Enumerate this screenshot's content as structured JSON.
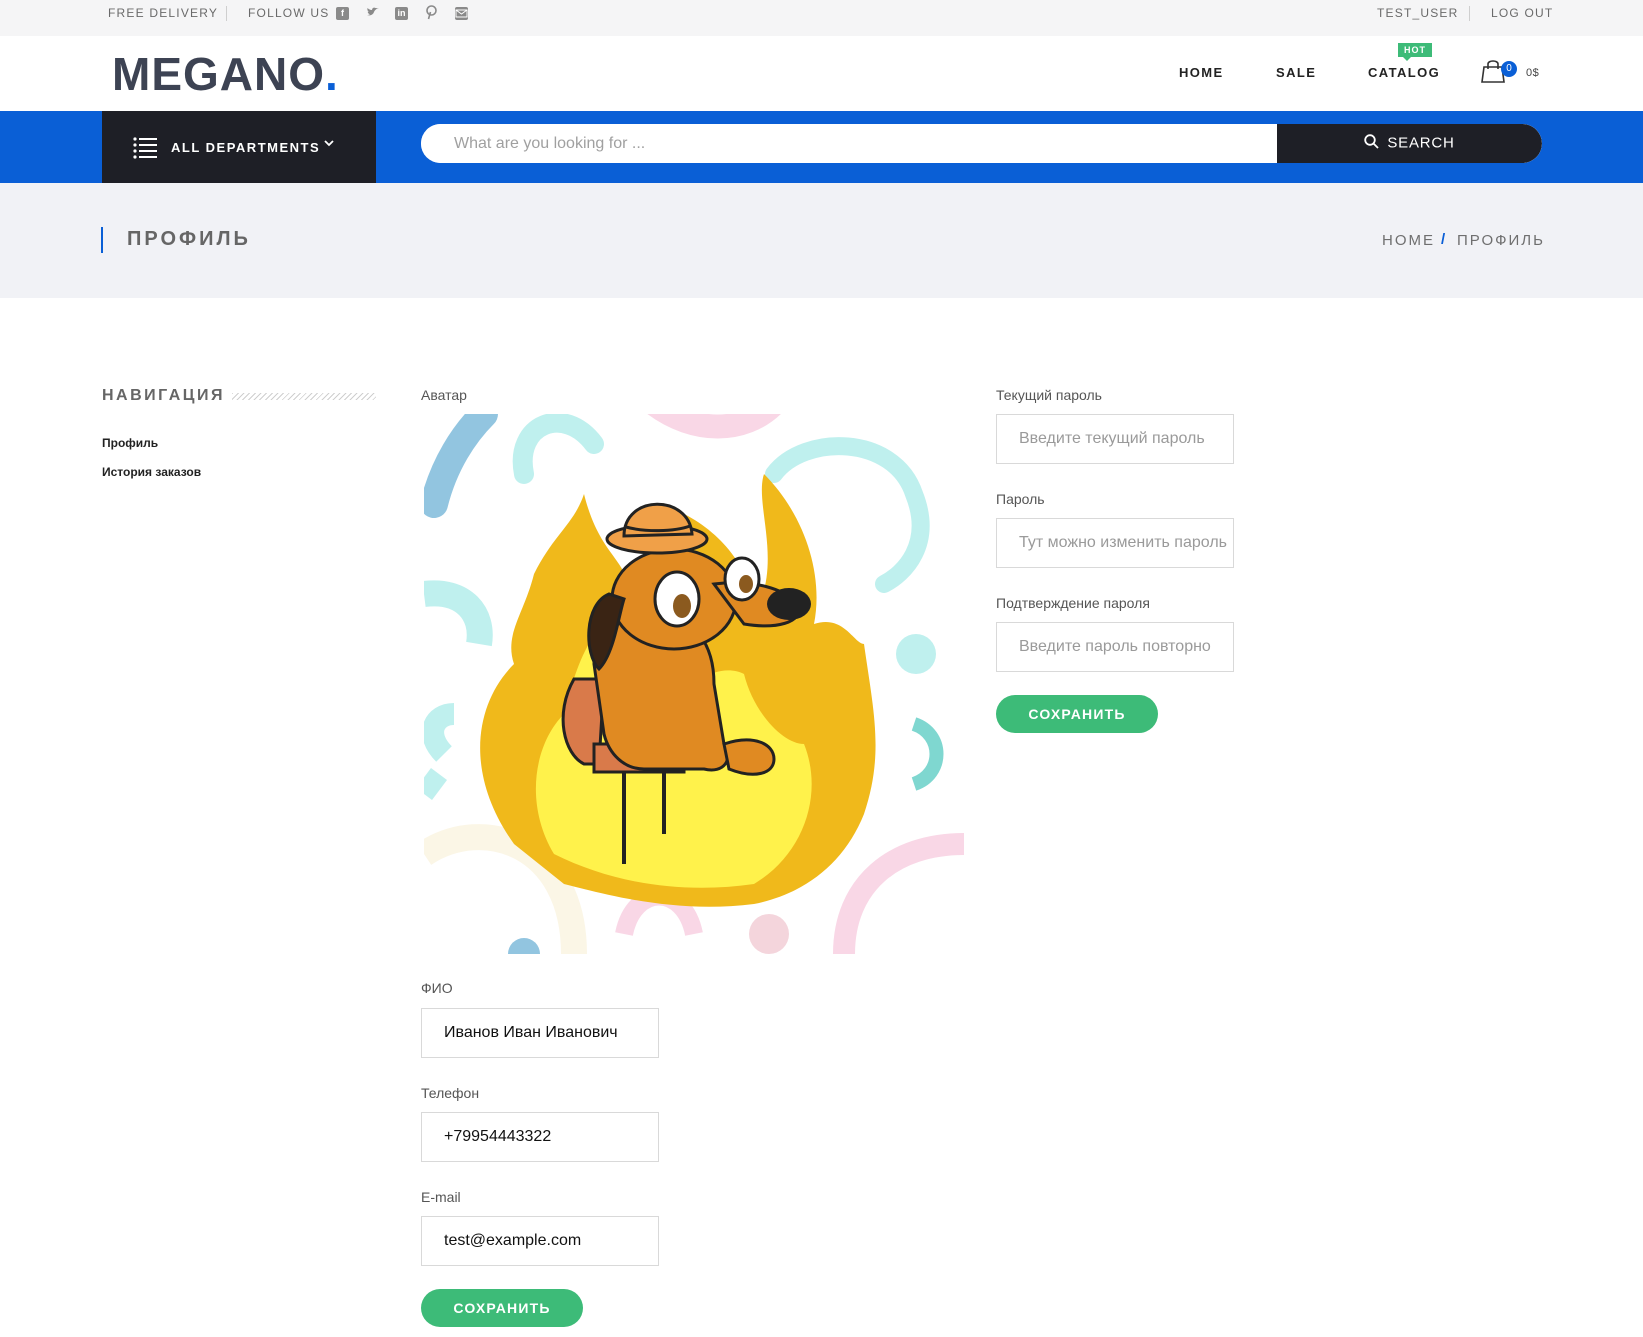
{
  "topbar": {
    "free_delivery": "FREE DELIVERY",
    "follow_us": "FOLLOW US",
    "username": "TEST_USER",
    "logout": "LOG OUT"
  },
  "header": {
    "logo_text": "MEGANO",
    "logo_dot": ".",
    "nav": [
      "HOME",
      "SALE",
      "CATALOG"
    ],
    "hot_badge": "HOT",
    "cart_count": "0",
    "cart_total": "0$"
  },
  "bluebar": {
    "departments_label": "ALL DEPARTMENTS",
    "search_placeholder": "What are you looking for ...",
    "search_button": "SEARCH"
  },
  "page": {
    "title": "ПРОФИЛЬ",
    "breadcrumb": [
      "HOME",
      "/",
      "ПРОФИЛЬ"
    ]
  },
  "sidebar": {
    "title": "НАВИГАЦИЯ",
    "items": [
      "Профиль",
      "История заказов"
    ]
  },
  "profile_form": {
    "avatar_label": "Аватар",
    "fio_label": "ФИО",
    "fio_value": "Иванов Иван Иванович",
    "phone_label": "Телефон",
    "phone_value": "+79954443322",
    "email_label": "E-mail",
    "email_value": "test@example.com",
    "save_label": "СОХРАНИТЬ"
  },
  "password_form": {
    "current_label": "Текущий пароль",
    "current_placeholder": "Введите текущий пароль",
    "password_label": "Пароль",
    "password_placeholder": "Тут можно изменить пароль",
    "confirm_label": "Подтверждение пароля",
    "confirm_placeholder": "Введите пароль повторно",
    "save_label": "СОХРАНИТЬ"
  },
  "colors": {
    "brand_blue": "#0a5fd6",
    "dark": "#1e1f26",
    "green": "#3dbb78",
    "title_bg": "#f1f2f6"
  },
  "icons": [
    "facebook-icon",
    "twitter-icon",
    "linkedin-icon",
    "pinterest-icon",
    "mail-icon",
    "cart-icon",
    "menu-icon",
    "chevron-down-icon",
    "search-icon"
  ]
}
